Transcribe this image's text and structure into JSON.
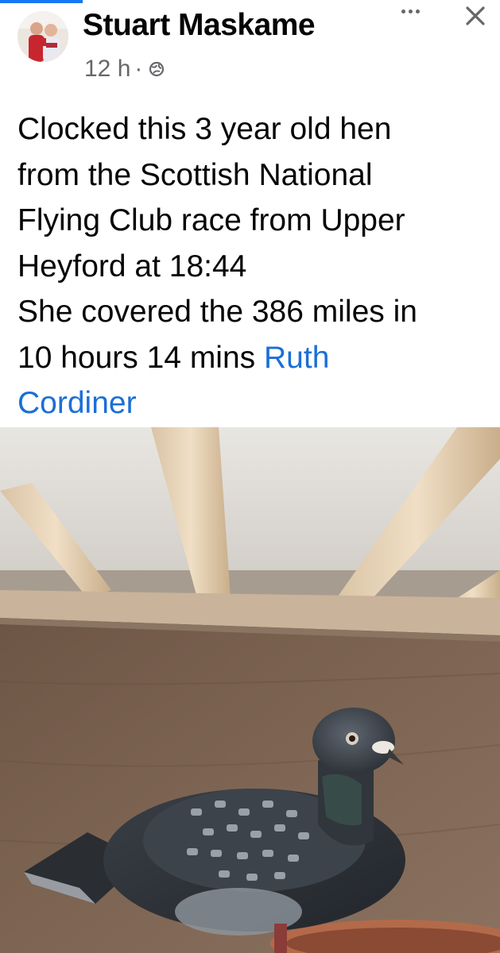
{
  "post": {
    "author": "Stuart Maskame",
    "time": "12 h",
    "separator": "·",
    "privacy_icon": "globe-icon",
    "more_icon": "more-icon",
    "close_icon": "close-icon",
    "text_lines": [
      "Clocked this 3 year old hen",
      "from the Scottish National",
      "Flying Club race from Upper",
      "Heyford at 18:44",
      "She covered the 386 miles in",
      "10 hours 14 mins "
    ],
    "mention_part1": "Ruth",
    "mention_part2": "Cordiner"
  },
  "colors": {
    "accent": "#1877f2",
    "mention": "#1b6fd6",
    "meta_text": "#65676b",
    "text": "#050505"
  },
  "photo": {
    "subject": "pigeon in loft"
  }
}
